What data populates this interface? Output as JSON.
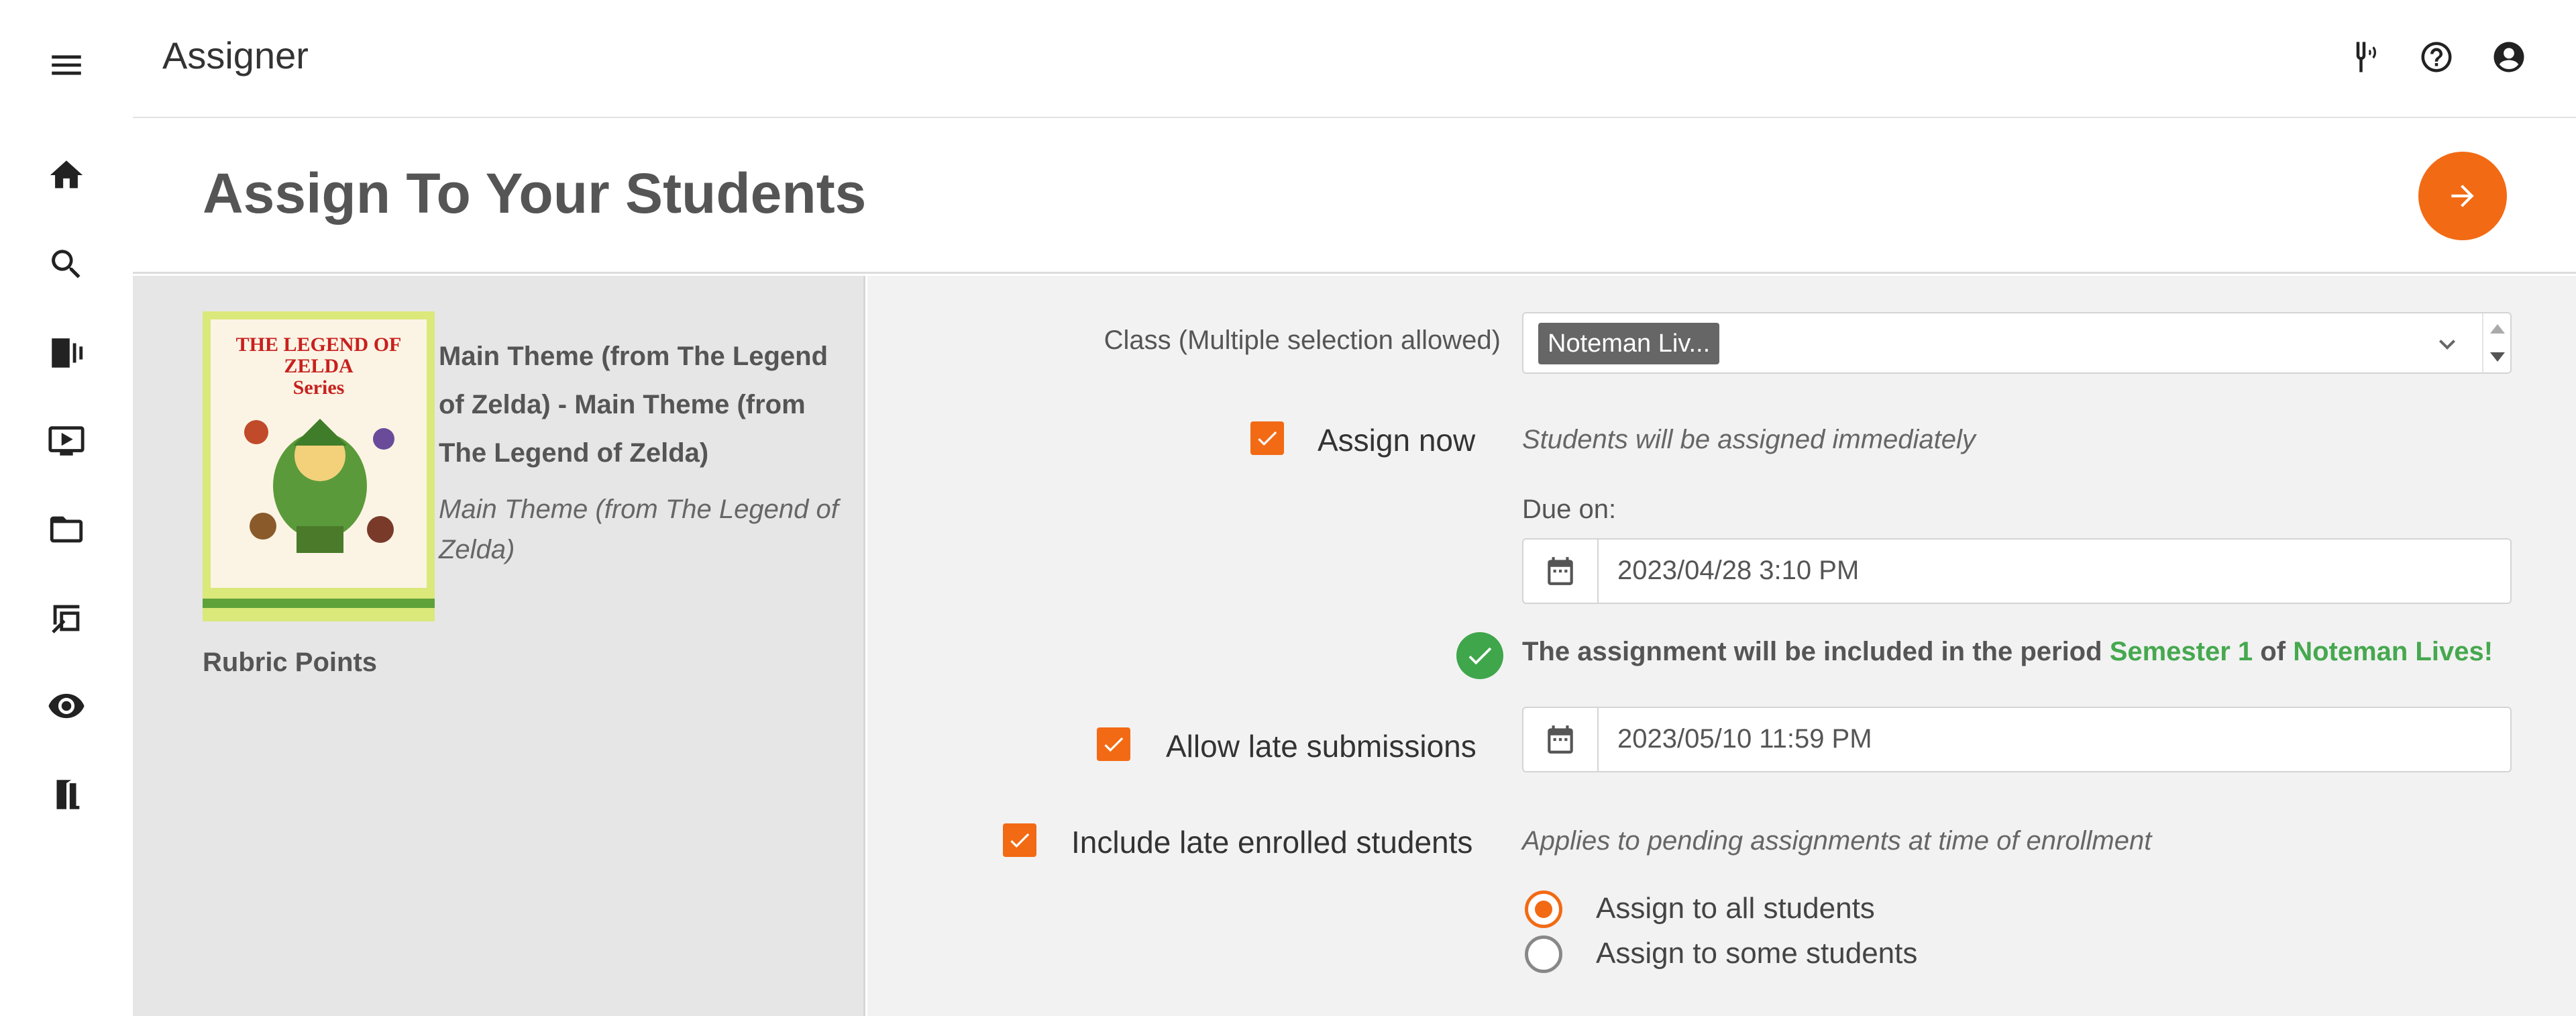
{
  "app": {
    "title": "Assigner"
  },
  "rail": {
    "items": [
      {
        "icon": "menu-icon"
      },
      {
        "icon": "home-icon"
      },
      {
        "icon": "search-icon"
      },
      {
        "icon": "library-icon"
      },
      {
        "icon": "video-icon"
      },
      {
        "icon": "folder-icon"
      },
      {
        "icon": "assign-icon"
      },
      {
        "icon": "eye-icon"
      },
      {
        "icon": "exit-icon"
      }
    ]
  },
  "topbar": {
    "icons": [
      "tuning-fork-icon",
      "help-icon",
      "account-icon"
    ]
  },
  "page": {
    "title": "Assign To Your Students"
  },
  "piece": {
    "cover_title_line1": "THE LEGEND OF ZELDA",
    "cover_title_line2": "Series",
    "title": "Main Theme (from The Legend of Zelda) - Main Theme (from The Legend of Zelda)",
    "subtitle": "Main Theme (from The Legend of Zelda)",
    "rubric_label": "Rubric Points"
  },
  "form": {
    "class_label": "Class (Multiple selection allowed)",
    "class_selected": "Noteman Liv...",
    "assign_now_label": "Assign now",
    "assign_now_checked": true,
    "assign_now_hint": "Students will be assigned immediately",
    "due_label": "Due on:",
    "due_value": "2023/04/28 3:10 PM",
    "period_prefix": "The assignment will be included in the period",
    "period_name": "Semester 1",
    "period_of": "of",
    "period_class": "Noteman Lives!",
    "late_label": "Allow late submissions",
    "late_checked": true,
    "late_value": "2023/05/10 11:59 PM",
    "late_enrolled_label": "Include late enrolled students",
    "late_enrolled_checked": true,
    "late_enrolled_hint": "Applies to pending assignments at time of enrollment",
    "radio_all": "Assign to all students",
    "radio_some": "Assign to some students",
    "radio_selected": "all"
  },
  "colors": {
    "accent": "#f26a14",
    "success": "#3fa64b"
  }
}
